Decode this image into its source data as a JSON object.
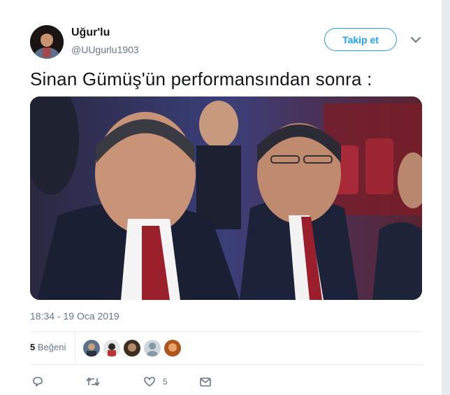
{
  "user": {
    "display_name": "Uğur'lu",
    "handle": "@UUgurlu1903"
  },
  "header": {
    "follow_label": "Takip et"
  },
  "tweet": {
    "text": "Sinan Gümüş'ün performansından sonra :",
    "timestamp": "18:34 - 19 Oca 2019"
  },
  "stats": {
    "likes_count": "5",
    "likes_label": "Beğeni"
  },
  "actions": {
    "like_count": "5"
  },
  "colors": {
    "accent": "#1da1f2",
    "secondary_text": "#657786",
    "divider": "#e6ecf0"
  },
  "icons": [
    "caret-down-icon",
    "reply-icon",
    "retweet-icon",
    "heart-icon",
    "envelope-icon"
  ]
}
